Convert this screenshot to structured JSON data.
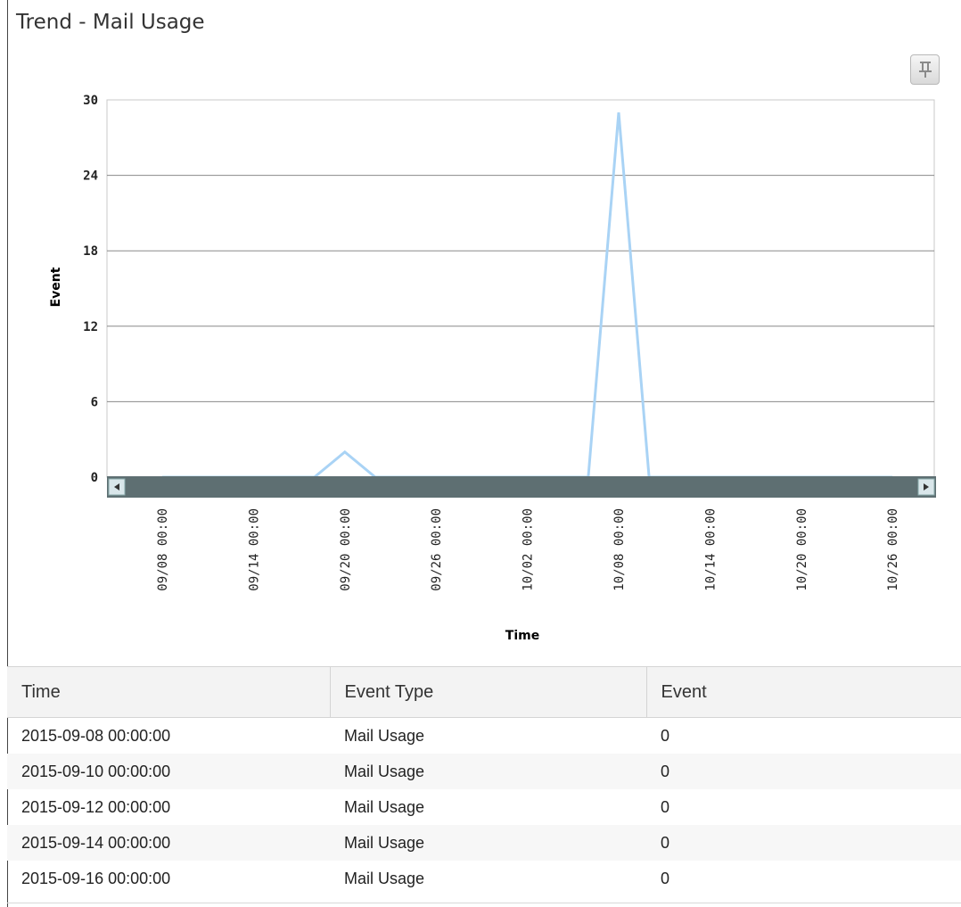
{
  "panel": {
    "title": "Trend - Mail Usage",
    "pin_icon": "pin-icon"
  },
  "chart_data": {
    "type": "line",
    "ylabel": "Event",
    "xlabel": "Time",
    "ylim": [
      0,
      30
    ],
    "yticks": [
      "30",
      "24",
      "18",
      "12",
      "6",
      "0"
    ],
    "xticks": [
      "09/08 00:00",
      "09/14 00:00",
      "09/20 00:00",
      "09/26 00:00",
      "10/02 00:00",
      "10/08 00:00",
      "10/14 00:00",
      "10/20 00:00",
      "10/26 00:00"
    ],
    "grid": true,
    "line_color": "#a9d3f5",
    "series": [
      {
        "x": [
          "2015-09-08",
          "2015-09-10",
          "2015-09-12",
          "2015-09-14",
          "2015-09-16",
          "2015-09-18",
          "2015-09-20",
          "2015-09-22",
          "2015-09-24",
          "2015-09-26",
          "2015-09-28",
          "2015-09-30",
          "2015-10-02",
          "2015-10-04",
          "2015-10-06",
          "2015-10-08",
          "2015-10-10",
          "2015-10-12",
          "2015-10-14",
          "2015-10-16",
          "2015-10-18",
          "2015-10-20",
          "2015-10-22",
          "2015-10-24",
          "2015-10-26"
        ],
        "y": [
          0,
          0,
          0,
          0,
          0,
          0,
          2,
          0,
          0,
          0,
          0,
          0,
          0,
          0,
          0,
          29,
          0,
          0,
          0,
          0,
          0,
          0,
          0,
          0,
          0
        ]
      }
    ]
  },
  "scrollbar": {
    "color": "#5e6f72",
    "left_arrow": "arrow-left-icon",
    "right_arrow": "arrow-right-icon"
  },
  "table": {
    "headers": [
      "Time",
      "Event Type",
      "Event"
    ],
    "rows": [
      [
        "2015-09-08 00:00:00",
        "Mail Usage",
        "0"
      ],
      [
        "2015-09-10 00:00:00",
        "Mail Usage",
        "0"
      ],
      [
        "2015-09-12 00:00:00",
        "Mail Usage",
        "0"
      ],
      [
        "2015-09-14 00:00:00",
        "Mail Usage",
        "0"
      ],
      [
        "2015-09-16 00:00:00",
        "Mail Usage",
        "0"
      ]
    ]
  }
}
